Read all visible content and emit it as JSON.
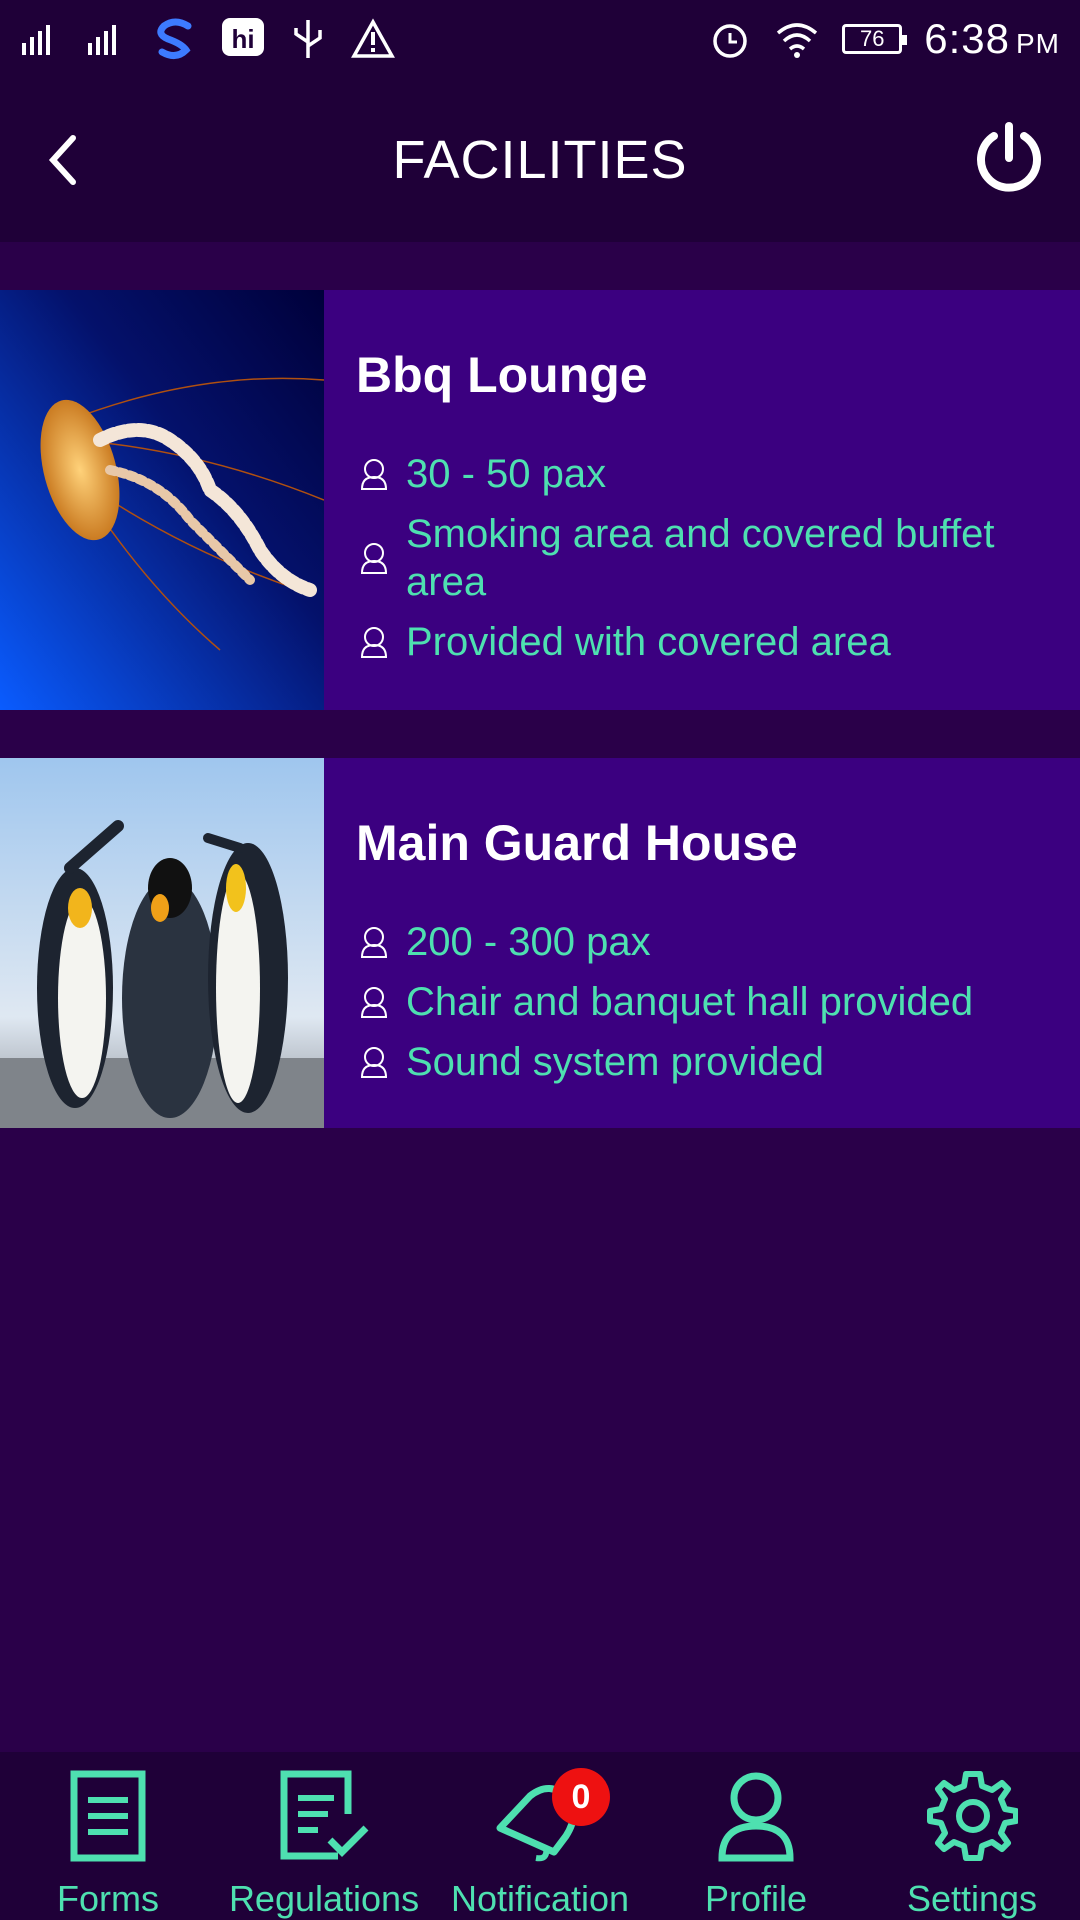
{
  "status_bar": {
    "time": "6:38",
    "ampm": "PM",
    "battery_level": "76",
    "icons": [
      "signal-icon",
      "signal-2-icon",
      "s-app-icon",
      "hi-app-icon",
      "usb-icon",
      "warning-icon",
      "alarm-icon",
      "wifi-icon",
      "battery-icon"
    ]
  },
  "header": {
    "title": "FACILITIES",
    "back_icon": "chevron-left-icon",
    "power_icon": "power-icon"
  },
  "facilities": [
    {
      "name": "Bbq Lounge",
      "image": "jellyfish-image",
      "features": [
        "30 - 50 pax",
        "Smoking area and covered buffet area",
        "Provided with covered area"
      ]
    },
    {
      "name": "Main Guard House",
      "image": "penguins-image",
      "features": [
        "200 - 300 pax",
        "Chair and banquet hall provided",
        "Sound system provided"
      ]
    }
  ],
  "bottom_nav": {
    "items": [
      {
        "label": "Forms",
        "icon": "document-icon"
      },
      {
        "label": "Regulations",
        "icon": "checklist-icon"
      },
      {
        "label": "Notification",
        "icon": "bell-icon",
        "badge": "0"
      },
      {
        "label": "Profile",
        "icon": "person-icon"
      },
      {
        "label": "Settings",
        "icon": "gear-icon"
      }
    ]
  },
  "colors": {
    "background": "#2a0049",
    "bar": "#1f0038",
    "card": "#3b0080",
    "accent": "#4ee0b0",
    "badge": "#ee1111"
  }
}
